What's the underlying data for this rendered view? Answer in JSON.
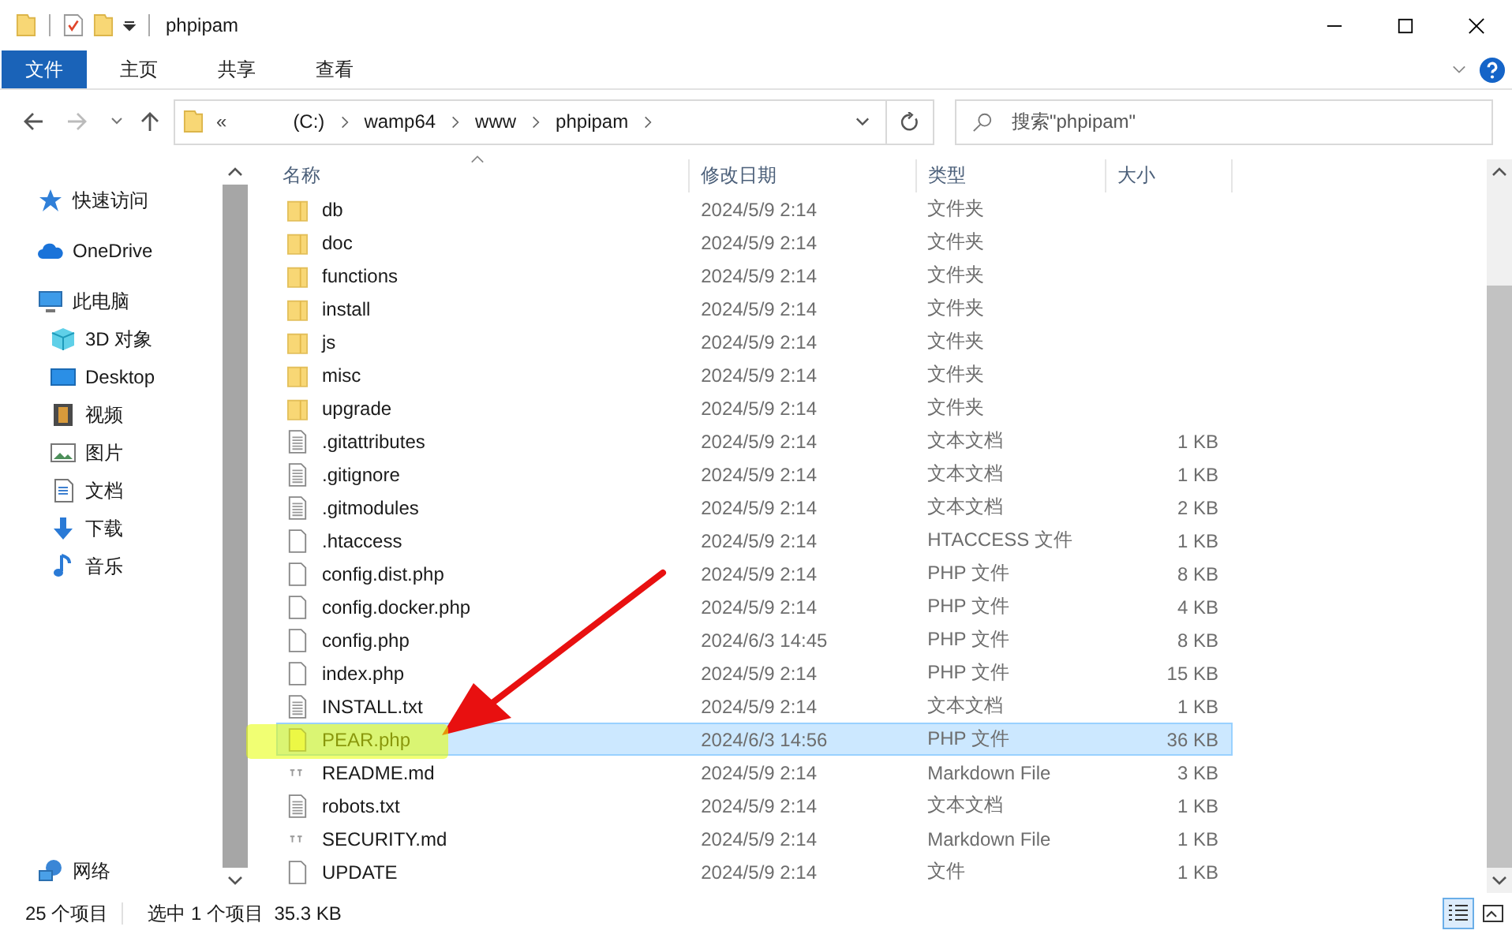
{
  "window": {
    "title": "phpipam"
  },
  "ribbon_tabs": [
    {
      "label": "文件",
      "selected": true
    },
    {
      "label": "主页",
      "selected": false
    },
    {
      "label": "共享",
      "selected": false
    },
    {
      "label": "查看",
      "selected": false
    }
  ],
  "address_bar": {
    "overflow": "«",
    "path": [
      "(C:)",
      "wamp64",
      "www",
      "phpipam"
    ]
  },
  "search": {
    "placeholder": "搜索\"phpipam\""
  },
  "sidebar": {
    "items": [
      {
        "label": "快速访问",
        "kind": "star"
      },
      {
        "label": "OneDrive",
        "kind": "cloud"
      },
      {
        "label": "此电脑",
        "kind": "pc",
        "children": [
          {
            "label": "3D 对象",
            "kind": "cube"
          },
          {
            "label": "Desktop",
            "kind": "desktop"
          },
          {
            "label": "视频",
            "kind": "video"
          },
          {
            "label": "图片",
            "kind": "image"
          },
          {
            "label": "文档",
            "kind": "doc"
          },
          {
            "label": "下载",
            "kind": "download"
          },
          {
            "label": "音乐",
            "kind": "music"
          }
        ]
      }
    ],
    "bottom_items": [
      {
        "label": "网络",
        "kind": "network"
      }
    ]
  },
  "table": {
    "columns": [
      "名称",
      "修改日期",
      "类型",
      "大小"
    ],
    "rows": [
      {
        "name": "db",
        "date": "2024/5/9 2:14",
        "type": "文件夹",
        "kind": "folder",
        "selected": false
      },
      {
        "name": "doc",
        "date": "2024/5/9 2:14",
        "type": "文件夹",
        "kind": "folder",
        "selected": false
      },
      {
        "name": "functions",
        "date": "2024/5/9 2:14",
        "type": "文件夹",
        "kind": "folder",
        "selected": false
      },
      {
        "name": "install",
        "date": "2024/5/9 2:14",
        "type": "文件夹",
        "kind": "folder",
        "selected": false
      },
      {
        "name": "js",
        "date": "2024/5/9 2:14",
        "type": "文件夹",
        "kind": "folder",
        "selected": false
      },
      {
        "name": "misc",
        "date": "2024/5/9 2:14",
        "type": "文件夹",
        "kind": "folder",
        "selected": false
      },
      {
        "name": "upgrade",
        "date": "2024/5/9 2:14",
        "type": "文件夹",
        "kind": "folder",
        "selected": false
      },
      {
        "name": ".gitattributes",
        "date": "2024/5/9 2:14",
        "type": "文本文档",
        "size": "1 KB",
        "kind": "text",
        "selected": false
      },
      {
        "name": ".gitignore",
        "date": "2024/5/9 2:14",
        "type": "文本文档",
        "size": "1 KB",
        "kind": "text",
        "selected": false
      },
      {
        "name": ".gitmodules",
        "date": "2024/5/9 2:14",
        "type": "文本文档",
        "size": "2 KB",
        "kind": "text",
        "selected": false
      },
      {
        "name": ".htaccess",
        "date": "2024/5/9 2:14",
        "type": "HTACCESS 文件",
        "size": "1 KB",
        "kind": "blank",
        "selected": false
      },
      {
        "name": "config.dist.php",
        "date": "2024/5/9 2:14",
        "type": "PHP 文件",
        "size": "8 KB",
        "kind": "blank",
        "selected": false
      },
      {
        "name": "config.docker.php",
        "date": "2024/5/9 2:14",
        "type": "PHP 文件",
        "size": "4 KB",
        "kind": "blank",
        "selected": false
      },
      {
        "name": "config.php",
        "date": "2024/6/3 14:45",
        "type": "PHP 文件",
        "size": "8 KB",
        "kind": "blank",
        "selected": false
      },
      {
        "name": "index.php",
        "date": "2024/5/9 2:14",
        "type": "PHP 文件",
        "size": "15 KB",
        "kind": "blank",
        "selected": false
      },
      {
        "name": "INSTALL.txt",
        "date": "2024/5/9 2:14",
        "type": "文本文档",
        "size": "1 KB",
        "kind": "text",
        "selected": false
      },
      {
        "name": "PEAR.php",
        "date": "2024/6/3 14:56",
        "type": "PHP 文件",
        "size": "36 KB",
        "kind": "blank",
        "selected": true
      },
      {
        "name": "README.md",
        "date": "2024/5/9 2:14",
        "type": "Markdown File",
        "size": "3 KB",
        "kind": "markdown",
        "selected": false
      },
      {
        "name": "robots.txt",
        "date": "2024/5/9 2:14",
        "type": "文本文档",
        "size": "1 KB",
        "kind": "text",
        "selected": false
      },
      {
        "name": "SECURITY.md",
        "date": "2024/5/9 2:14",
        "type": "Markdown File",
        "size": "1 KB",
        "kind": "markdown",
        "selected": false
      },
      {
        "name": "UPDATE",
        "date": "2024/5/9 2:14",
        "type": "文件",
        "size": "1 KB",
        "kind": "blank",
        "selected": false
      }
    ]
  },
  "status_bar": {
    "count": "25 个项目",
    "selection": "选中 1 个项目  35.3 KB"
  },
  "view_buttons": [
    {
      "kind": "details",
      "selected": true
    },
    {
      "kind": "tiles",
      "selected": false
    }
  ]
}
